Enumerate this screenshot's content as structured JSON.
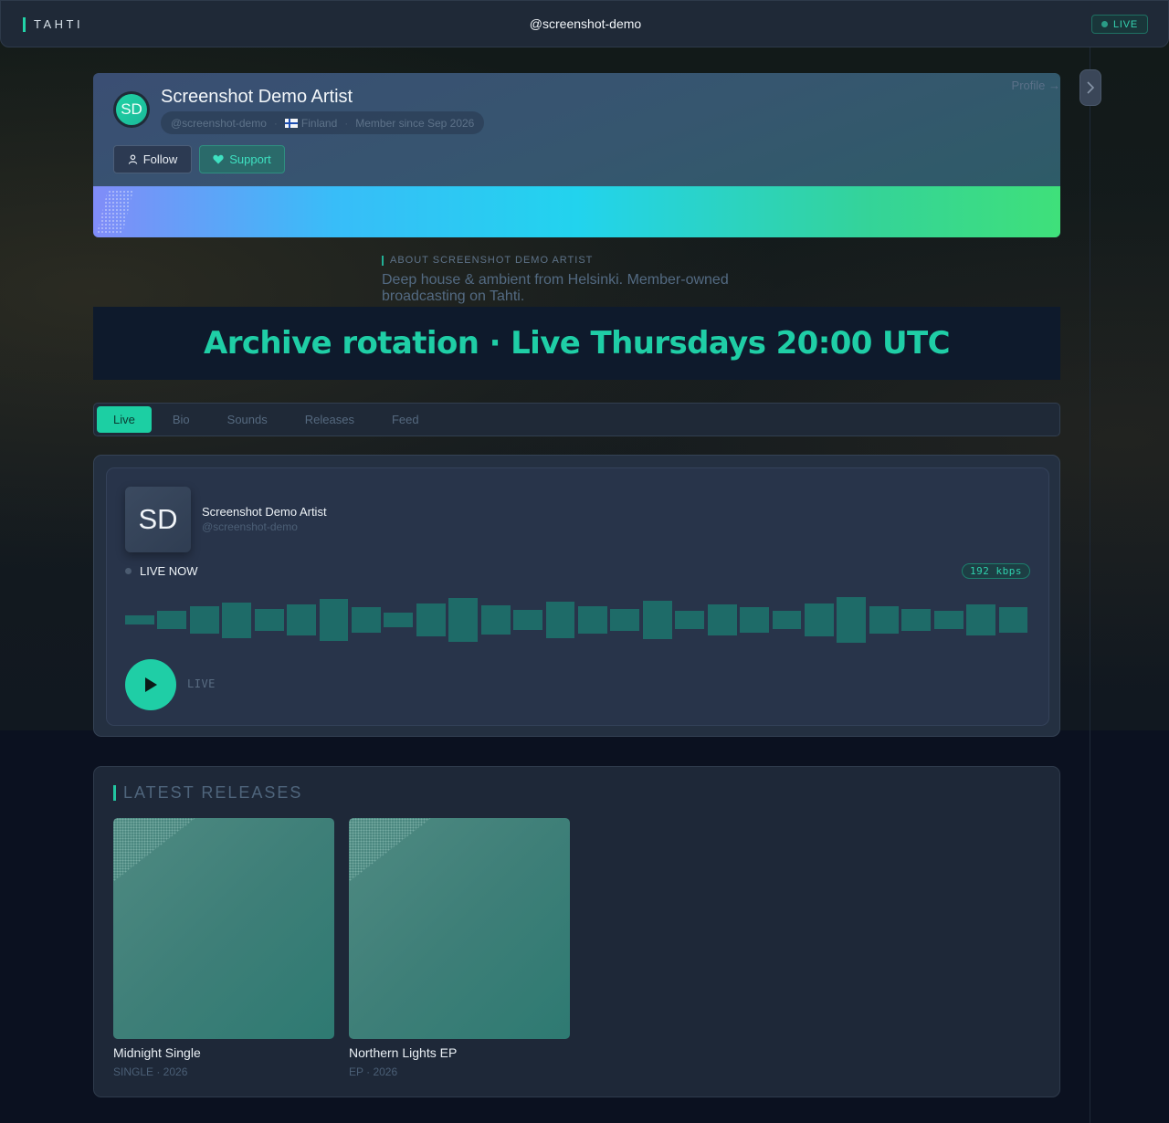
{
  "header": {
    "brand": "TAHTI",
    "handle": "@screenshot-demo",
    "live_badge": "LIVE"
  },
  "profile": {
    "link_label": "Profile →",
    "avatar_initials": "SD",
    "name": "Screenshot Demo Artist",
    "handle": "@screenshot-demo",
    "country": "Finland",
    "member_since": "Member since Sep 2026",
    "follow_label": "Follow",
    "support_label": "Support"
  },
  "about": {
    "label": "ABOUT SCREENSHOT DEMO ARTIST",
    "text": "Deep house & ambient from Helsinki. Member-owned broadcasting on Tahti."
  },
  "schedule": {
    "text": "Archive rotation · Live Thursdays 20:00 UTC"
  },
  "tabs": [
    {
      "label": "Live",
      "active": true
    },
    {
      "label": "Bio",
      "active": false
    },
    {
      "label": "Sounds",
      "active": false
    },
    {
      "label": "Releases",
      "active": false
    },
    {
      "label": "Feed",
      "active": false
    }
  ],
  "player": {
    "avatar_initials": "SD",
    "artist": "Screenshot Demo Artist",
    "handle": "@screenshot-demo",
    "status": "LIVE NOW",
    "bitrate": "192 kbps",
    "play_label": "LIVE",
    "waveform_levels": [
      0.2,
      0.38,
      0.58,
      0.75,
      0.46,
      0.67,
      0.88,
      0.52,
      0.3,
      0.71,
      0.94,
      0.6,
      0.42,
      0.77,
      0.57,
      0.46,
      0.81,
      0.37,
      0.65,
      0.52,
      0.4,
      0.71,
      0.98,
      0.56,
      0.46,
      0.37,
      0.65,
      0.54
    ]
  },
  "releases": {
    "title": "LATEST RELEASES",
    "items": [
      {
        "name": "Midnight Single",
        "meta": "SINGLE · 2026"
      },
      {
        "name": "Northern Lights EP",
        "meta": "EP · 2026"
      }
    ]
  },
  "colors": {
    "accent": "#1fcea6",
    "panel": "#243041",
    "background": "#0c1220"
  }
}
